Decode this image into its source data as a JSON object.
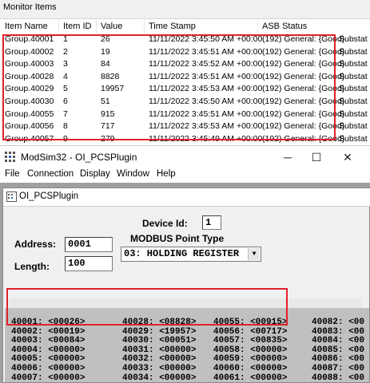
{
  "monitor": {
    "title": "Monitor Items",
    "columns": [
      "Item Name",
      "Item ID",
      "Value",
      "Time Stamp",
      "ASB Status"
    ],
    "rows": [
      {
        "name": "Group.40001",
        "id": "1",
        "value": "26",
        "ts": "11/11/2022 3:45:50 AM +00:00",
        "status": "(192) General: {Good}",
        "sub": "Substat"
      },
      {
        "name": "Group.40002",
        "id": "2",
        "value": "19",
        "ts": "11/11/2022 3:45:51 AM +00:00",
        "status": "(192) General: {Good}",
        "sub": "Substat"
      },
      {
        "name": "Group.40003",
        "id": "3",
        "value": "84",
        "ts": "11/11/2022 3:45:52 AM +00:00",
        "status": "(192) General: {Good}",
        "sub": "Substat"
      },
      {
        "name": "Group.40028",
        "id": "4",
        "value": "8828",
        "ts": "11/11/2022 3:45:51 AM +00:00",
        "status": "(192) General: {Good}",
        "sub": "Substat"
      },
      {
        "name": "Group.40029",
        "id": "5",
        "value": "19957",
        "ts": "11/11/2022 3:45:53 AM +00:00",
        "status": "(192) General: {Good}",
        "sub": "Substat"
      },
      {
        "name": "Group.40030",
        "id": "6",
        "value": "51",
        "ts": "11/11/2022 3:45:50 AM +00:00",
        "status": "(192) General: {Good}",
        "sub": "Substat"
      },
      {
        "name": "Group.40055",
        "id": "7",
        "value": "915",
        "ts": "11/11/2022 3:45:51 AM +00:00",
        "status": "(192) General: {Good}",
        "sub": "Substat"
      },
      {
        "name": "Group.40056",
        "id": "8",
        "value": "717",
        "ts": "11/11/2022 3:45:53 AM +00:00",
        "status": "(192) General: {Good}",
        "sub": "Substat"
      },
      {
        "name": "Group.40057",
        "id": "9",
        "value": "279",
        "ts": "11/11/2022 3:45:49 AM +00:00",
        "status": "(192) General: {Good}",
        "sub": "Substat"
      }
    ]
  },
  "window": {
    "title": "ModSim32 - OI_PCSPlugin",
    "controls": {
      "minimize": "─",
      "maximize": "☐",
      "close": "✕"
    },
    "menu": [
      "File",
      "Connection",
      "Display",
      "Window",
      "Help"
    ]
  },
  "child": {
    "title": "OI_PCSPlugin",
    "device_id_label": "Device Id:",
    "device_id": "1",
    "address_label": "Address:",
    "address": "0001",
    "length_label": "Length:",
    "length": "100",
    "point_type_label": "MODBUS Point Type",
    "point_type": "03: HOLDING REGISTER"
  },
  "registers": {
    "columns": [
      [
        "40001: <00026>",
        "40002: <00019>",
        "40003: <00084>",
        "40004: <00000>",
        "40005: <00000>",
        "40006: <00000>",
        "40007: <00000>",
        "40008: <00000>"
      ],
      [
        "40028: <08828>",
        "40029: <19957>",
        "40030: <00051>",
        "40031: <00000>",
        "40032: <00000>",
        "40033: <00000>",
        "40034: <00000>",
        "40035: <00000>"
      ],
      [
        "40055: <00915>",
        "40056: <00717>",
        "40057: <00835>",
        "40058: <00000>",
        "40059: <00000>",
        "40060: <00000>",
        "40061: <00000>",
        "40062: <00000>"
      ],
      [
        "40082: <00",
        "40083: <00",
        "40084: <00",
        "40085: <00",
        "40086: <00",
        "40087: <00",
        "40088: <00",
        "40089: <00"
      ]
    ]
  },
  "colors": {
    "highlight": "#e0202a",
    "register_bg": "#c0c0c0"
  }
}
